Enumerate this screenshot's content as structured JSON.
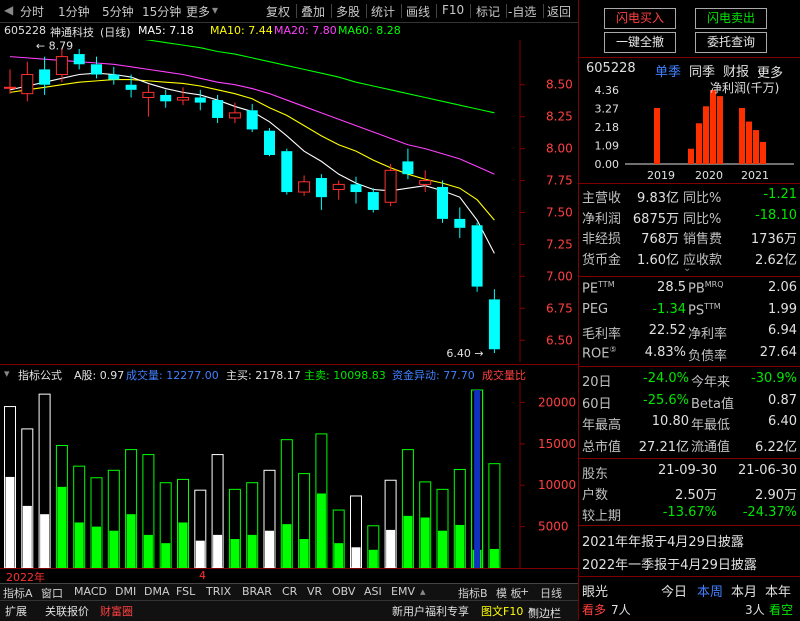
{
  "toolbar": {
    "items": [
      "分时",
      "1分钟",
      "5分钟",
      "15分钟",
      "更多",
      "复权",
      "叠加",
      "多股",
      "统计",
      "画线",
      "F10",
      "标记",
      "自选",
      "返回"
    ]
  },
  "title": {
    "code": "605228",
    "name": "神通科技",
    "period": "(日线)",
    "ma5": "MA5: 7.18",
    "ma10": "MA10: 7.44",
    "ma20": "MA20: 7.80",
    "ma60": "MA60: 8.28"
  },
  "colors": {
    "up": "#ff3030",
    "down": "#00ffff",
    "ma5": "#ffffff",
    "ma10": "#ffff00",
    "ma20": "#ff40ff",
    "ma60": "#00ff00"
  },
  "chart_data": [
    {
      "type": "candlestick",
      "yticks": [
        "8.50",
        "8.25",
        "8.00",
        "7.75",
        "7.50",
        "7.25",
        "7.00",
        "6.75",
        "6.50"
      ],
      "ylim": [
        6.33,
        8.85
      ],
      "high_label": "8.79",
      "low_label": "6.40",
      "candles": [
        {
          "o": 8.48,
          "c": 8.48,
          "h": 8.62,
          "l": 8.43
        },
        {
          "o": 8.43,
          "c": 8.58,
          "h": 8.68,
          "l": 8.37
        },
        {
          "o": 8.62,
          "c": 8.5,
          "h": 8.72,
          "l": 8.42
        },
        {
          "o": 8.58,
          "c": 8.72,
          "h": 8.79,
          "l": 8.52
        },
        {
          "o": 8.74,
          "c": 8.66,
          "h": 8.78,
          "l": 8.62
        },
        {
          "o": 8.66,
          "c": 8.58,
          "h": 8.72,
          "l": 8.55
        },
        {
          "o": 8.58,
          "c": 8.54,
          "h": 8.64,
          "l": 8.5
        },
        {
          "o": 8.5,
          "c": 8.46,
          "h": 8.58,
          "l": 8.4
        },
        {
          "o": 8.4,
          "c": 8.44,
          "h": 8.5,
          "l": 8.25
        },
        {
          "o": 8.42,
          "c": 8.37,
          "h": 8.46,
          "l": 8.32
        },
        {
          "o": 8.38,
          "c": 8.4,
          "h": 8.48,
          "l": 8.34
        },
        {
          "o": 8.4,
          "c": 8.36,
          "h": 8.46,
          "l": 8.3
        },
        {
          "o": 8.38,
          "c": 8.24,
          "h": 8.42,
          "l": 8.2
        },
        {
          "o": 8.24,
          "c": 8.28,
          "h": 8.36,
          "l": 8.2
        },
        {
          "o": 8.3,
          "c": 8.15,
          "h": 8.35,
          "l": 8.13
        },
        {
          "o": 8.14,
          "c": 7.95,
          "h": 8.16,
          "l": 7.94
        },
        {
          "o": 7.98,
          "c": 7.66,
          "h": 8.0,
          "l": 7.64
        },
        {
          "o": 7.66,
          "c": 7.74,
          "h": 7.79,
          "l": 7.63
        },
        {
          "o": 7.77,
          "c": 7.62,
          "h": 7.8,
          "l": 7.52
        },
        {
          "o": 7.68,
          "c": 7.72,
          "h": 7.75,
          "l": 7.6
        },
        {
          "o": 7.72,
          "c": 7.66,
          "h": 7.78,
          "l": 7.57
        },
        {
          "o": 7.66,
          "c": 7.52,
          "h": 7.69,
          "l": 7.5
        },
        {
          "o": 7.58,
          "c": 7.83,
          "h": 7.88,
          "l": 7.55
        },
        {
          "o": 7.9,
          "c": 7.8,
          "h": 8.0,
          "l": 7.76
        },
        {
          "o": 7.72,
          "c": 7.75,
          "h": 7.83,
          "l": 7.66
        },
        {
          "o": 7.7,
          "c": 7.45,
          "h": 7.75,
          "l": 7.42
        },
        {
          "o": 7.45,
          "c": 7.38,
          "h": 7.54,
          "l": 7.3
        },
        {
          "o": 7.4,
          "c": 6.92,
          "h": 7.42,
          "l": 6.88
        },
        {
          "o": 6.82,
          "c": 6.43,
          "h": 6.9,
          "l": 6.4
        }
      ],
      "ma5": [
        8.46,
        8.49,
        8.52,
        8.55,
        8.58,
        8.59,
        8.58,
        8.56,
        8.51,
        8.47,
        8.44,
        8.42,
        8.38,
        8.33,
        8.29,
        8.21,
        8.1,
        7.98,
        7.9,
        7.8,
        7.73,
        7.68,
        7.67,
        7.69,
        7.71,
        7.67,
        7.62,
        7.44,
        7.18
      ],
      "ma10": [
        8.44,
        8.46,
        8.48,
        8.5,
        8.52,
        8.53,
        8.54,
        8.54,
        8.53,
        8.52,
        8.51,
        8.49,
        8.46,
        8.43,
        8.39,
        8.32,
        8.26,
        8.18,
        8.1,
        8.03,
        7.98,
        7.91,
        7.85,
        7.8,
        7.76,
        7.73,
        7.69,
        7.6,
        7.44
      ],
      "ma20": [
        8.72,
        8.71,
        8.7,
        8.69,
        8.68,
        8.67,
        8.66,
        8.64,
        8.62,
        8.6,
        8.58,
        8.55,
        8.52,
        8.5,
        8.47,
        8.43,
        8.38,
        8.33,
        8.28,
        8.23,
        8.18,
        8.13,
        8.08,
        8.03,
        8.0,
        7.96,
        7.92,
        7.86,
        7.8
      ],
      "ma60": [
        8.97,
        8.96,
        8.95,
        8.93,
        8.92,
        8.9,
        8.89,
        8.87,
        8.85,
        8.83,
        8.81,
        8.79,
        8.76,
        8.74,
        8.71,
        8.68,
        8.65,
        8.62,
        8.59,
        8.56,
        8.52,
        8.49,
        8.46,
        8.43,
        8.4,
        8.37,
        8.34,
        8.31,
        8.28
      ]
    },
    {
      "type": "bar",
      "yticks": [
        "20000",
        "15000",
        "10000",
        "5000"
      ],
      "ylim": [
        0,
        21500
      ],
      "volume": [
        19500,
        16800,
        21000,
        14800,
        12300,
        10900,
        11800,
        14300,
        13700,
        10300,
        10700,
        9400,
        13700,
        9500,
        10300,
        11800,
        15500,
        11400,
        16200,
        7000,
        8700,
        5100,
        10600,
        14300,
        10400,
        9500,
        11900,
        21500,
        12600
      ],
      "inner": [
        11000,
        7500,
        6500,
        9800,
        5500,
        5000,
        4500,
        6500,
        4000,
        3000,
        5500,
        3300,
        4000,
        3500,
        4000,
        4500,
        5300,
        3500,
        9000,
        3000,
        2500,
        2200,
        4600,
        6300,
        6100,
        4500,
        5200,
        2200,
        2300
      ],
      "hollow_white": [
        true,
        true,
        true,
        false,
        false,
        false,
        false,
        false,
        false,
        false,
        false,
        true,
        true,
        false,
        false,
        true,
        false,
        false,
        false,
        false,
        true,
        false,
        true,
        false,
        false,
        false,
        false,
        false,
        false
      ],
      "inner_white": [
        true,
        true,
        true,
        false,
        false,
        false,
        false,
        false,
        false,
        false,
        false,
        true,
        true,
        false,
        false,
        true,
        false,
        false,
        false,
        false,
        true,
        false,
        true,
        false,
        false,
        false,
        false,
        false,
        false
      ]
    }
  ],
  "vol_header": {
    "label": "指标公式",
    "ashare": "A股: 0.97",
    "vol": "成交量: 12277.00",
    "buy": "主买: 2178.17",
    "sell": "主卖: 10098.83",
    "flow": "资金异动: 77.70",
    "ratio": "成交量比"
  },
  "datebar": {
    "year": "2022年",
    "month": "4"
  },
  "tabs": [
    "指标A",
    "窗口",
    "MACD",
    "DMI",
    "DMA",
    "FSL",
    "TRIX",
    "BRAR",
    "CR",
    "VR",
    "OBV",
    "ASI",
    "EMV",
    "指标B",
    "模 板",
    "+",
    "日线"
  ],
  "bottombar": {
    "expand": "扩展",
    "invest": "关联报价",
    "wealth": "财富圈",
    "promo": "新用户福利专享",
    "f10": "图文F10",
    "sidebar": "侧边栏"
  },
  "right": {
    "buy_btn": "闪电买入",
    "sell_btn": "闪电卖出",
    "clear_btn": "一键全撤",
    "query_btn": "委托查询",
    "code": "605228",
    "tab_quarter": "单季",
    "tab_yoy": "同季",
    "tab_report": "财报",
    "tab_more": "更多",
    "profit_title": "净利润(千万)",
    "profit_yticks": [
      "4.36",
      "3.27",
      "2.18",
      "1.09",
      "0.00"
    ],
    "profit_years": [
      "2019",
      "2020",
      "2021"
    ],
    "profit_chart": {
      "type": "bar",
      "values": [
        3.3,
        0,
        0,
        0.9,
        2.4,
        3.4,
        4.36,
        4.0,
        0,
        3.3,
        2.5,
        2.0,
        1.3
      ]
    },
    "fin": [
      [
        "主营收",
        "9.83亿",
        "同比%",
        "-1.21"
      ],
      [
        "净利润",
        "6875万",
        "同比%",
        "-18.10"
      ],
      [
        "非经损",
        "768万",
        "销售费",
        "1736万"
      ],
      [
        "货币金",
        "1.60亿",
        "应收款",
        "2.62亿"
      ]
    ],
    "val": [
      [
        "PE",
        "TTM",
        "28.5",
        "PB",
        "MRQ",
        "2.06"
      ],
      [
        "PEG",
        "",
        "-1.34",
        "PS",
        "TTM",
        "1.99"
      ],
      [
        "毛利率",
        "",
        "22.52",
        "净利率",
        "",
        "6.94"
      ],
      [
        "ROE",
        "⑤",
        "4.83%",
        "负债率",
        "",
        "27.64"
      ]
    ],
    "perf": [
      [
        "20日",
        "-24.0%",
        "今年来",
        "-30.9%"
      ],
      [
        "60日",
        "-25.6%",
        "Beta值",
        "0.87"
      ],
      [
        "年最高",
        "10.80",
        "年最低",
        "6.40"
      ],
      [
        "总市值",
        "27.21亿",
        "流通值",
        "6.22亿"
      ]
    ],
    "holders": [
      [
        "股东",
        "21-09-30",
        "21-06-30"
      ],
      [
        "户数",
        "2.50万",
        "2.90万"
      ],
      [
        "较上期",
        "-13.67%",
        "-24.37%"
      ]
    ],
    "notice1": "2021年年报于4月29日披露",
    "notice2": "2022年一季报于4月29日披露",
    "eye": {
      "label": "眼光",
      "today": "今日",
      "week": "本周",
      "month": "本月",
      "year": "本年"
    },
    "bottom": {
      "bull": "看多",
      "bull_n": "7人",
      "bear": "看空",
      "bear_n": "3人"
    }
  }
}
